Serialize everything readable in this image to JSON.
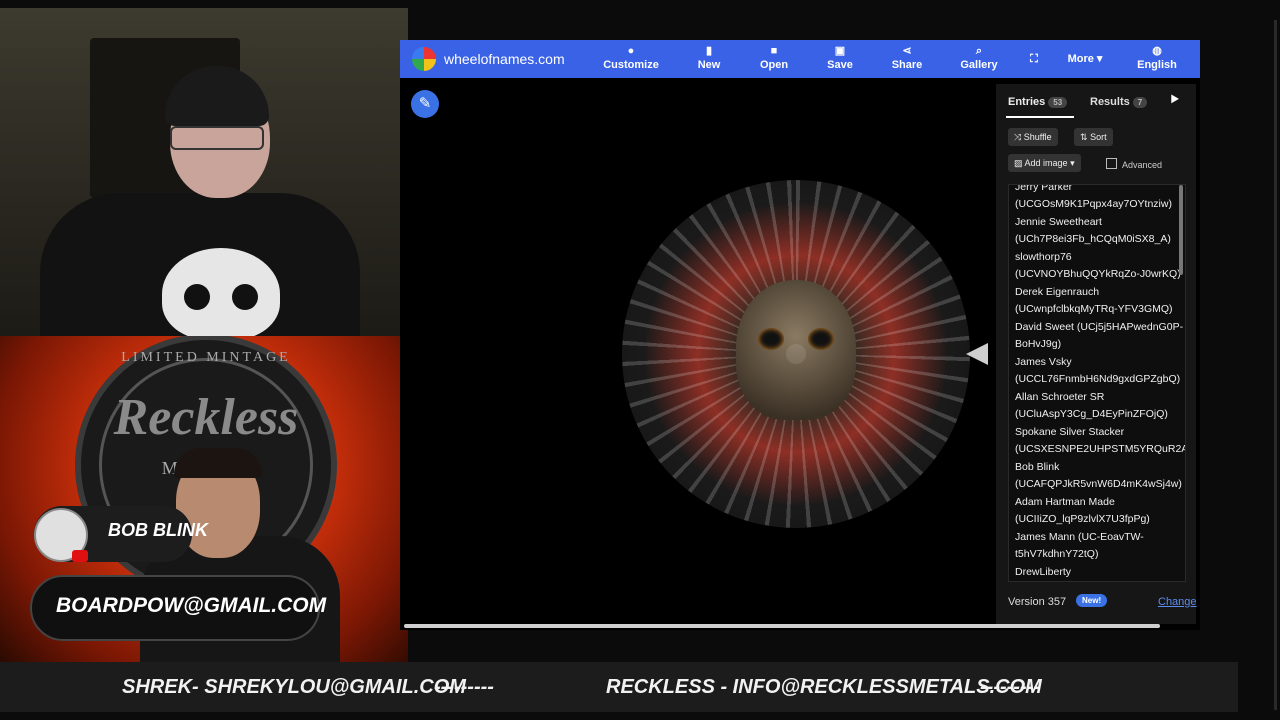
{
  "browser": {
    "site_name": "wheelofnames.com",
    "toolbar": [
      {
        "label": "Customize",
        "icon": "palette-icon"
      },
      {
        "label": "New",
        "icon": "file-icon"
      },
      {
        "label": "Open",
        "icon": "folder-icon"
      },
      {
        "label": "Save",
        "icon": "save-icon"
      },
      {
        "label": "Share",
        "icon": "share-icon"
      },
      {
        "label": "Gallery",
        "icon": "search-icon"
      },
      {
        "label": "",
        "icon": "fullscreen-icon"
      },
      {
        "label": "More",
        "icon": "chevron-down-icon"
      },
      {
        "label": "English",
        "icon": "globe-icon"
      }
    ],
    "accent_color": "#3a62e6"
  },
  "panel": {
    "tab_entries": "Entries",
    "entries_count": "53",
    "tab_results": "Results",
    "results_count": "7",
    "shuffle_label": "Shuffle",
    "sort_label": "Sort",
    "add_image_label": "Add image",
    "advanced_label": "Advanced",
    "entries": [
      "Jerry Parker",
      "(UCGOsM9K1Pqpx4ay7OYtnziw)",
      "Jennie Sweetheart",
      "(UCh7P8ei3Fb_hCQqM0iSX8_A)",
      "slowthorp76",
      "(UCVNOYBhuQQYkRqZo-J0wrKQ)",
      "Derek Eigenrauch",
      "(UCwnpfclbkqMyTRq-YFV3GMQ)",
      "David Sweet (UCj5j5HAPwednG0P-",
      "BoHvJ9g)",
      "James Vsky",
      "(UCCL76FnmbH6Nd9gxdGPZgbQ)",
      "Allan Schroeter SR",
      "(UCluAspY3Cg_D4EyPinZFOjQ)",
      "Spokane Silver Stacker",
      "(UCSXESNPE2UHPSTM5YRQuR2A)",
      "Bob Blink",
      "(UCAFQPJkR5vnW6D4mK4wSj4w)",
      "Adam Hartman Made",
      "(UCIIiZO_lqP9zlvlX7U3fpPg)",
      "James Mann (UC-EoavTW-",
      "t5hV7kdhnY72tQ)",
      "DrewLiberty"
    ],
    "version_label": "Version 357",
    "new_badge": "New!",
    "change_link": "Change"
  },
  "overlay": {
    "guest_name": "BOB BLINK",
    "guest_email": "BOARDPOW@GMAIL.COM",
    "background_logo_text": {
      "top": "LIMITED MINTAGE",
      "main": "Reckless",
      "bottom": "METALS"
    }
  },
  "ticker": {
    "left": "SHREK- SHREKYLOU@GMAIL.COM",
    "left_dashes": "---------",
    "right": "RECKLESS - INFO@RECKLESSMETALS.COM",
    "right_dashes": "---------"
  }
}
